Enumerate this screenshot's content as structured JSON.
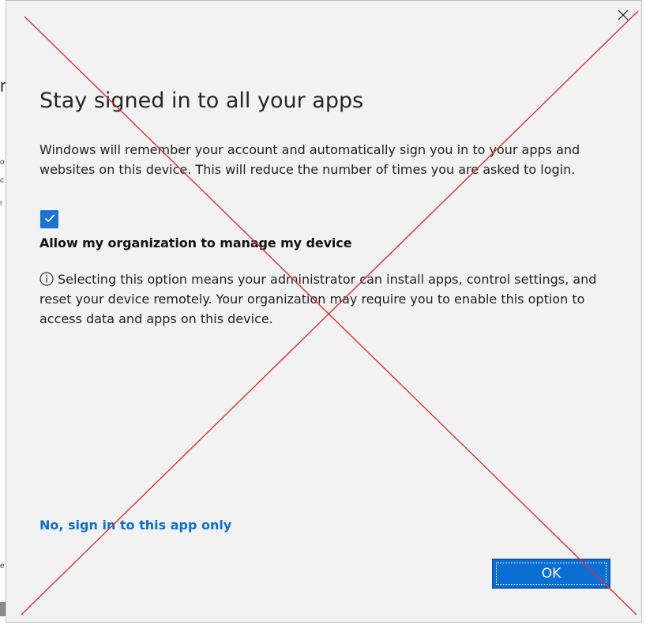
{
  "dialog": {
    "title": "Stay signed in to all your apps",
    "description": "Windows will remember your account and automatically sign you in to your apps and websites on this device. This will reduce the number of times you are asked to login.",
    "checkbox": {
      "checked": true,
      "label": "Allow my organization to manage my device"
    },
    "info_text": "Selecting this option means your administrator can install apps, control settings, and reset your device remotely. Your organization may require you to enable this option to access data and apps on this device.",
    "link_text": "No, sign in to this app only",
    "ok_label": "OK",
    "close_glyph": "×"
  },
  "icons": {
    "close": "close-icon",
    "checkmark": "checkmark-icon",
    "info": "info-icon"
  },
  "colors": {
    "accent": "#0a6fd4",
    "checkbox": "#1a73d1",
    "link": "#0b6fcf",
    "overlay_cross": "#e03030",
    "dialog_bg": "#f2f2f2"
  }
}
